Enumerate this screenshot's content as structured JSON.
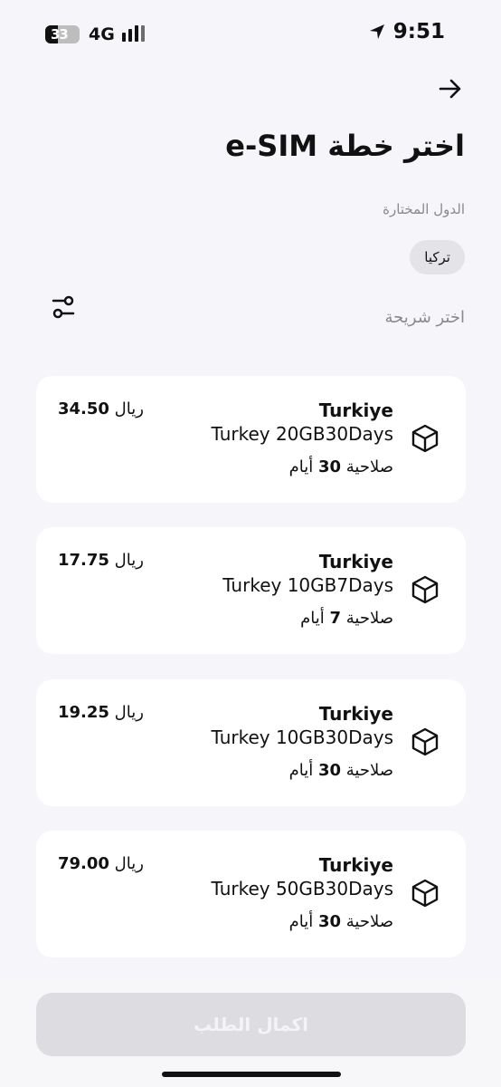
{
  "status_bar": {
    "battery": "33",
    "network": "4G",
    "time": "9:51"
  },
  "header": {
    "title": "اختر خطة e-SIM"
  },
  "countries": {
    "label": "الدول المختارة",
    "chips": [
      "تركيا"
    ]
  },
  "plans_section": {
    "label": "اختر شريحة"
  },
  "currency": "ريال",
  "plans": [
    {
      "country": "Turkiye",
      "name": "Turkey 20GB30Days",
      "price": "34.50",
      "validity_prefix": "صلاحية",
      "validity_num": "30",
      "validity_unit": "أيام"
    },
    {
      "country": "Turkiye",
      "name": "Turkey 10GB7Days",
      "price": "17.75",
      "validity_prefix": "صلاحية",
      "validity_num": "7",
      "validity_unit": "أيام"
    },
    {
      "country": "Turkiye",
      "name": "Turkey 10GB30Days",
      "price": "19.25",
      "validity_prefix": "صلاحية",
      "validity_num": "30",
      "validity_unit": "أيام"
    },
    {
      "country": "Turkiye",
      "name": "Turkey 50GB30Days",
      "price": "79.00",
      "validity_prefix": "صلاحية",
      "validity_num": "30",
      "validity_unit": "أيام"
    }
  ],
  "footer": {
    "submit_label": "اكمال الطلب"
  },
  "icons": {
    "back": "arrow-right-icon",
    "filter": "sliders-icon",
    "plan": "cube-icon",
    "location": "location-arrow-icon"
  }
}
